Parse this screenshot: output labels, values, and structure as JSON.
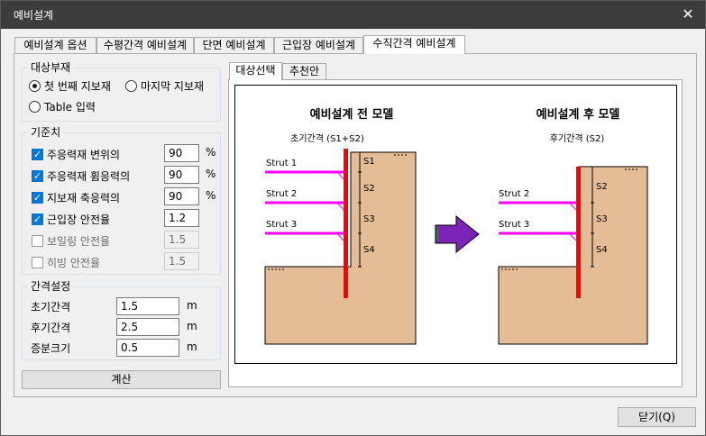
{
  "window": {
    "title": "예비설계",
    "close_glyph": "✕"
  },
  "tabs": [
    {
      "label": "예비설계 옵션"
    },
    {
      "label": "수평간격 예비설계"
    },
    {
      "label": "단면 예비설계"
    },
    {
      "label": "근입장 예비설계"
    },
    {
      "label": "수직간격 예비설계",
      "active": true
    }
  ],
  "target_group": {
    "legend": "대상부재",
    "options": [
      {
        "label": "첫 번째 지보재",
        "selected": true
      },
      {
        "label": "마지막 지보재",
        "selected": false
      },
      {
        "label": "Table 입력",
        "selected": false
      }
    ]
  },
  "criteria_group": {
    "legend": "기준치",
    "rows": [
      {
        "label": "주응력재 변위의",
        "checked": true,
        "value": "90",
        "unit": "%",
        "enabled": true
      },
      {
        "label": "주응력재 휨응력의",
        "checked": true,
        "value": "90",
        "unit": "%",
        "enabled": true
      },
      {
        "label": "지보재 축응력의",
        "checked": true,
        "value": "90",
        "unit": "%",
        "enabled": true
      },
      {
        "label": "근입장 안전율",
        "checked": true,
        "value": "1.2",
        "unit": "",
        "enabled": true
      },
      {
        "label": "보일링 안전율",
        "checked": false,
        "value": "1.5",
        "unit": "",
        "enabled": false
      },
      {
        "label": "히빙 안전율",
        "checked": false,
        "value": "1.5",
        "unit": "",
        "enabled": false
      }
    ]
  },
  "spacing_group": {
    "legend": "간격설정",
    "rows": [
      {
        "label": "초기간격",
        "value": "1.5",
        "unit": "m"
      },
      {
        "label": "후기간격",
        "value": "2.5",
        "unit": "m"
      },
      {
        "label": "증분크기",
        "value": "0.5",
        "unit": "m"
      }
    ]
  },
  "calc_button": "계산",
  "subtabs": [
    {
      "label": "대상선택",
      "active": true
    },
    {
      "label": "추천안",
      "active": false
    }
  ],
  "diagram": {
    "before_title": "예비설계 전 모델",
    "after_title": "예비설계 후 모델",
    "before_caption": "초기간격   (S1+S2)",
    "after_caption": "후기간격   (S2)",
    "before_struts": [
      "Strut 1",
      "Strut 2",
      "Strut 3"
    ],
    "after_struts": [
      "Strut 2",
      "Strut 3"
    ],
    "before_spacings": [
      "S1",
      "S2",
      "S3",
      "S4"
    ],
    "after_spacings": [
      "S2",
      "S3",
      "S4"
    ],
    "colors": {
      "soil": "#e4bd96",
      "wall": "#ff0000",
      "strut": "#ff00ff",
      "arrow": "#7b24b5"
    }
  },
  "close_button": "닫기(Q)"
}
